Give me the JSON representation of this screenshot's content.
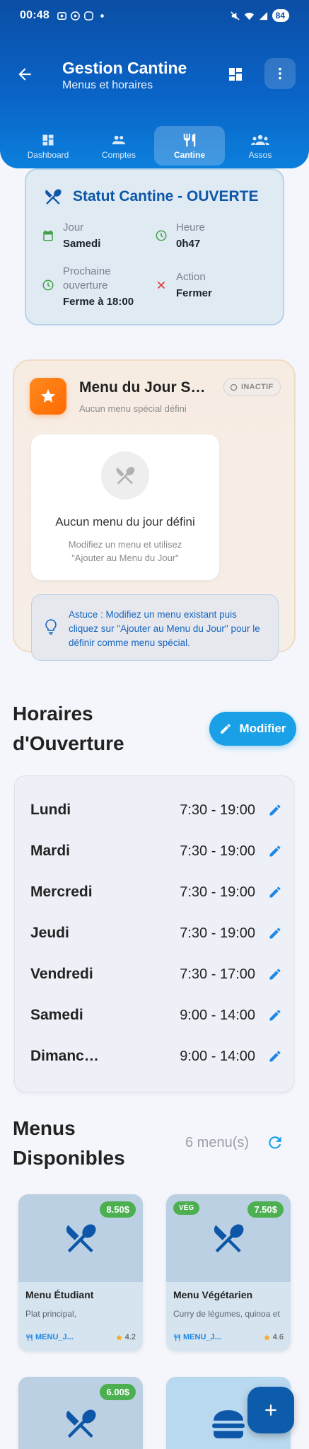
{
  "status_bar": {
    "time": "00:48",
    "battery": "84"
  },
  "header": {
    "title": "Gestion Cantine",
    "subtitle": "Menus et horaires"
  },
  "tabs": [
    {
      "label": "Dashboard",
      "icon": "dashboard-icon"
    },
    {
      "label": "Comptes",
      "icon": "people-icon"
    },
    {
      "label": "Cantine",
      "icon": "restaurant-icon",
      "active": true
    },
    {
      "label": "Assos",
      "icon": "groups-icon"
    }
  ],
  "status_card": {
    "title": "Statut Cantine - OUVERTE",
    "day_label": "Jour",
    "day_value": "Samedi",
    "hour_label": "Heure",
    "hour_value": "0h47",
    "next_label": "Prochaine ouverture",
    "next_value": "Ferme à 18:00",
    "action_label": "Action",
    "action_value": "Fermer"
  },
  "special_menu": {
    "title": "Menu du Jour Spécial",
    "subtitle": "Aucun menu spécial défini",
    "badge": "INACTIF",
    "empty_title": "Aucun menu du jour défini",
    "empty_desc": "Modifiez un menu et utilisez \"Ajouter au Menu du Jour\"",
    "tip": "Astuce : Modifiez un menu existant puis cliquez sur \"Ajouter au Menu du Jour\" pour le définir comme menu spécial."
  },
  "hours": {
    "heading": "Horaires d'Ouverture",
    "edit_label": "Modifier",
    "rows": [
      {
        "day": "Lundi",
        "time": "7:30 - 19:00"
      },
      {
        "day": "Mardi",
        "time": "7:30 - 19:00"
      },
      {
        "day": "Mercredi",
        "time": "7:30 - 19:00"
      },
      {
        "day": "Jeudi",
        "time": "7:30 - 19:00"
      },
      {
        "day": "Vendredi",
        "time": "7:30 - 17:00"
      },
      {
        "day": "Samedi",
        "time": "9:00 - 14:00"
      },
      {
        "day": "Dimanche",
        "time": "9:00 - 14:00"
      }
    ]
  },
  "menus": {
    "heading": "Menus Disponibles",
    "count": "6 menu(s)",
    "items": [
      {
        "name": "Menu Étudiant",
        "desc": "Plat principal,",
        "price": "8.50$",
        "category": "MENU_J...",
        "rating": "4.2"
      },
      {
        "name": "Menu Végétarien",
        "desc": "Curry de légumes, quinoa et",
        "price": "7.50$",
        "badge": "VÉG",
        "category": "MENU_J...",
        "rating": "4.6"
      },
      {
        "price": "6.00$"
      },
      {}
    ]
  },
  "colors": {
    "primary": "#0a63c6",
    "accent": "#1aa0e6",
    "success": "#4caf50",
    "warning": "#ff7a00",
    "danger": "#e53935"
  }
}
